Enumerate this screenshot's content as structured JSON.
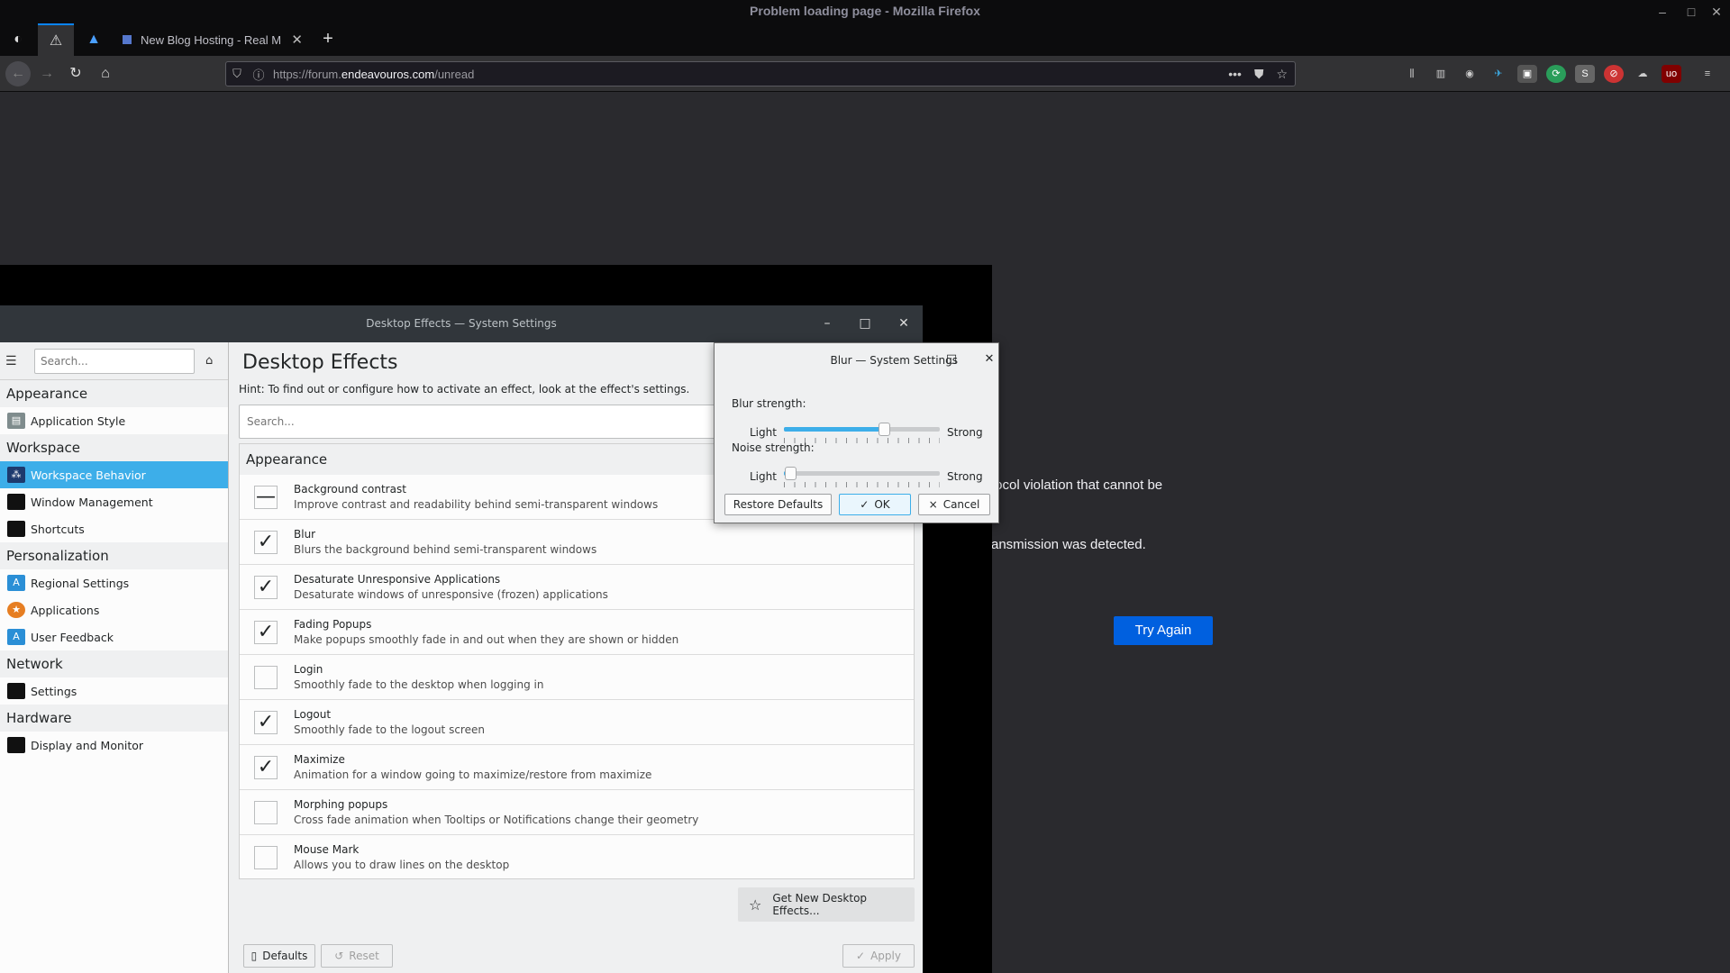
{
  "firefox": {
    "window_title": "Problem loading page - Mozilla Firefox",
    "tabs": [
      {
        "label": "New Blog Hosting - Real M"
      }
    ],
    "url": {
      "prefix": "https://forum.",
      "host": "endeavouros.com",
      "path": "/unread"
    },
    "error_page": {
      "line1": "tocol violation that cannot be",
      "line2": "ansmission was detected.",
      "try_again": "Try Again"
    }
  },
  "settings": {
    "window_title": "Desktop Effects — System Settings",
    "search_placeholder": "Search...",
    "sidebar": [
      {
        "category": "Appearance",
        "items": [
          {
            "label": "Application Style",
            "icon": "application-style-icon",
            "selected": false
          }
        ]
      },
      {
        "category": "Workspace",
        "items": [
          {
            "label": "Workspace Behavior",
            "icon": "workspace-behavior-icon",
            "selected": true
          },
          {
            "label": "Window Management",
            "icon": "window-management-icon",
            "selected": false
          },
          {
            "label": "Shortcuts",
            "icon": "shortcuts-icon",
            "selected": false
          }
        ]
      },
      {
        "category": "Personalization",
        "items": [
          {
            "label": "Regional Settings",
            "icon": "regional-settings-icon",
            "selected": false
          },
          {
            "label": "Applications",
            "icon": "applications-icon",
            "selected": false
          },
          {
            "label": "User Feedback",
            "icon": "user-feedback-icon",
            "selected": false
          }
        ]
      },
      {
        "category": "Network",
        "items": [
          {
            "label": "Settings",
            "icon": "network-settings-icon",
            "selected": false
          }
        ]
      },
      {
        "category": "Hardware",
        "items": [
          {
            "label": "Display and Monitor",
            "icon": "display-monitor-icon",
            "selected": false
          }
        ]
      }
    ],
    "main": {
      "title": "Desktop Effects",
      "hint": "Hint: To find out or configure how to activate an effect, look at the effect's settings.",
      "search_placeholder": "Search...",
      "group": "Appearance",
      "effects": [
        {
          "name": "Background contrast",
          "desc": "Improve contrast and readability behind semi-transparent windows",
          "state": "partial"
        },
        {
          "name": "Blur",
          "desc": "Blurs the background behind semi-transparent windows",
          "state": "checked"
        },
        {
          "name": "Desaturate Unresponsive Applications",
          "desc": "Desaturate windows of unresponsive (frozen) applications",
          "state": "checked"
        },
        {
          "name": "Fading Popups",
          "desc": "Make popups smoothly fade in and out when they are shown or hidden",
          "state": "checked"
        },
        {
          "name": "Login",
          "desc": "Smoothly fade to the desktop when logging in",
          "state": "unchecked"
        },
        {
          "name": "Logout",
          "desc": "Smoothly fade to the logout screen",
          "state": "checked"
        },
        {
          "name": "Maximize",
          "desc": "Animation for a window going to maximize/restore from maximize",
          "state": "checked"
        },
        {
          "name": "Morphing popups",
          "desc": "Cross fade animation when Tooltips or Notifications change their geometry",
          "state": "unchecked"
        },
        {
          "name": "Mouse Mark",
          "desc": "Allows you to draw lines on the desktop",
          "state": "unchecked"
        }
      ],
      "get_new": "Get New Desktop Effects...",
      "defaults": "Defaults",
      "reset": "Reset",
      "apply": "Apply"
    }
  },
  "blur_dialog": {
    "title": "Blur — System Settings",
    "blur_label": "Blur strength:",
    "noise_label": "Noise strength:",
    "light": "Light",
    "strong": "Strong",
    "blur_value_fraction": 0.64,
    "noise_value_fraction": 0.04,
    "restore_defaults": "Restore Defaults",
    "ok": "OK",
    "cancel": "Cancel"
  }
}
